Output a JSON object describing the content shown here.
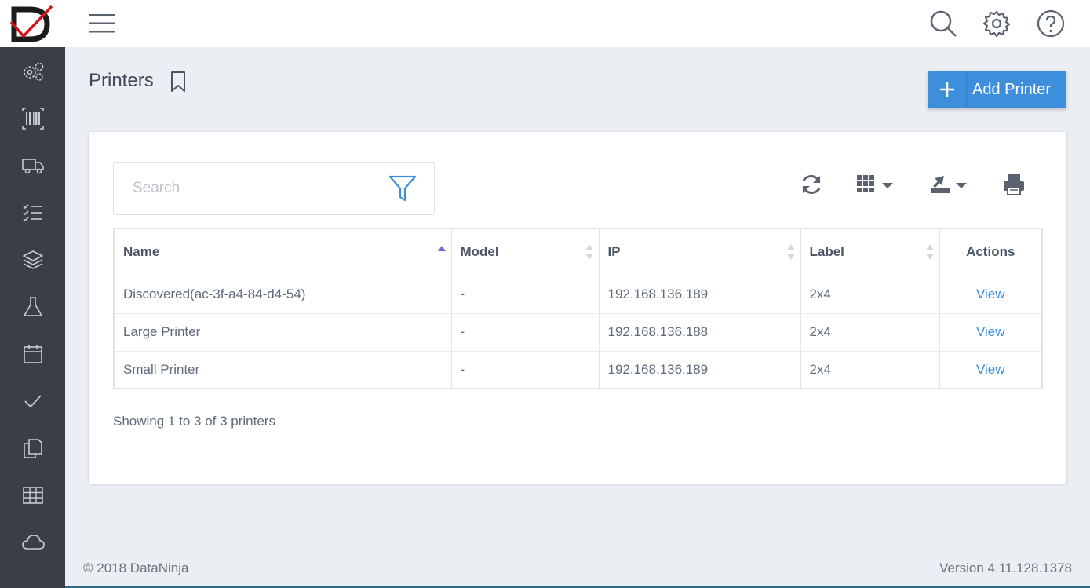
{
  "header": {
    "logo_text": "D",
    "menu_icon": "hamburger-icon",
    "icons": [
      "search-icon",
      "gear-icon",
      "help-icon"
    ]
  },
  "sidebar": {
    "items": [
      {
        "icon": "gears-icon"
      },
      {
        "icon": "barcode-icon"
      },
      {
        "icon": "truck-icon"
      },
      {
        "icon": "checklist-icon"
      },
      {
        "icon": "layers-icon"
      },
      {
        "icon": "flask-icon"
      },
      {
        "icon": "calendar-icon"
      },
      {
        "icon": "check-icon"
      },
      {
        "icon": "copy-icon"
      },
      {
        "icon": "table-icon"
      },
      {
        "icon": "cloud-icon"
      }
    ]
  },
  "page": {
    "title": "Printers",
    "add_button_label": "Add Printer"
  },
  "search": {
    "placeholder": "Search",
    "value": ""
  },
  "toolbar": {
    "icons": [
      "refresh-icon",
      "columns-icon",
      "export-icon",
      "print-icon"
    ]
  },
  "table": {
    "columns": [
      "Name",
      "Model",
      "IP",
      "Label",
      "Actions"
    ],
    "sort_column": "Name",
    "sort_direction": "ascending",
    "rows": [
      {
        "name": "Discovered(ac-3f-a4-84-d4-54)",
        "model": "-",
        "ip": "192.168.136.189",
        "label": "2x4",
        "action": "View"
      },
      {
        "name": "Large Printer",
        "model": "-",
        "ip": "192.168.136.188",
        "label": "2x4",
        "action": "View"
      },
      {
        "name": "Small Printer",
        "model": "-",
        "ip": "192.168.136.189",
        "label": "2x4",
        "action": "View"
      }
    ],
    "summary": "Showing 1 to 3 of 3 printers"
  },
  "footer": {
    "copyright": "© 2018 DataNinja",
    "version": "Version 4.11.128.1378"
  },
  "colors": {
    "accent": "#3d8fdc",
    "sidebar": "#3a3f47",
    "logo_red": "#d0161f"
  }
}
